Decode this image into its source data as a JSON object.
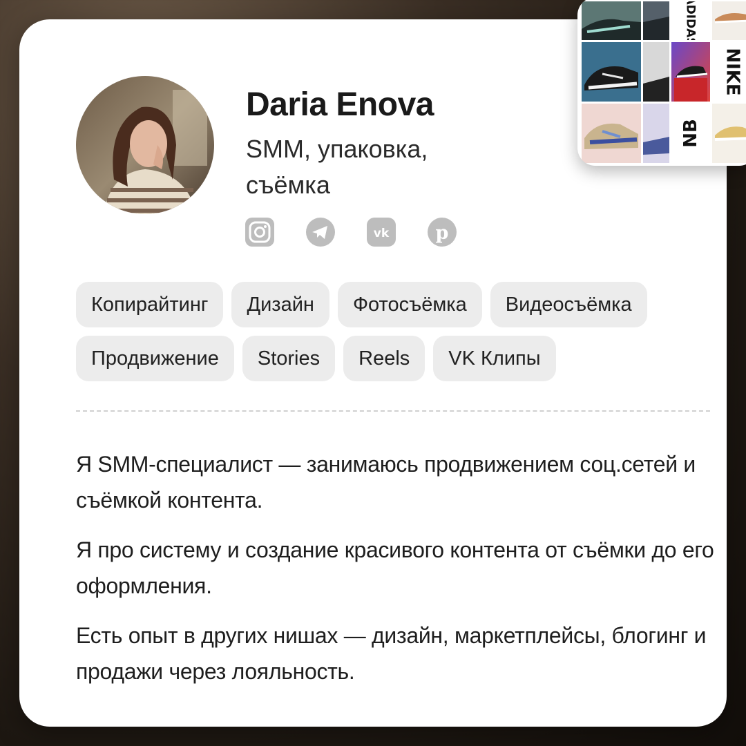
{
  "profile": {
    "name": "Daria Enova",
    "role": "SMM, упаковка, съёмка"
  },
  "socials": [
    {
      "icon": "instagram-icon"
    },
    {
      "icon": "telegram-icon"
    },
    {
      "icon": "vk-icon"
    },
    {
      "icon": "pinterest-icon"
    }
  ],
  "tags": [
    "Копирайтинг",
    "Дизайн",
    "Фотосъёмка",
    "Видеосъёмка",
    "Продвижение",
    "Stories",
    "Reels",
    "VK Клипы"
  ],
  "bio": [
    "Я SMM-специалист — занимаюсь продвижением соц.сетей и съёмкой контента.",
    "Я про систему и создание красивого контента от съёмки до его оформления.",
    "Есть опыт в других нишах — дизайн, маркетплейсы, блогинг и продажи через лояльность."
  ],
  "collage": {
    "brands": [
      "ADIDAS",
      "NIKE",
      "NB"
    ]
  },
  "colors": {
    "card": "#ffffff",
    "tag_bg": "#ececec",
    "icon_gray": "#b8b8b8",
    "text": "#1e1e1e"
  }
}
